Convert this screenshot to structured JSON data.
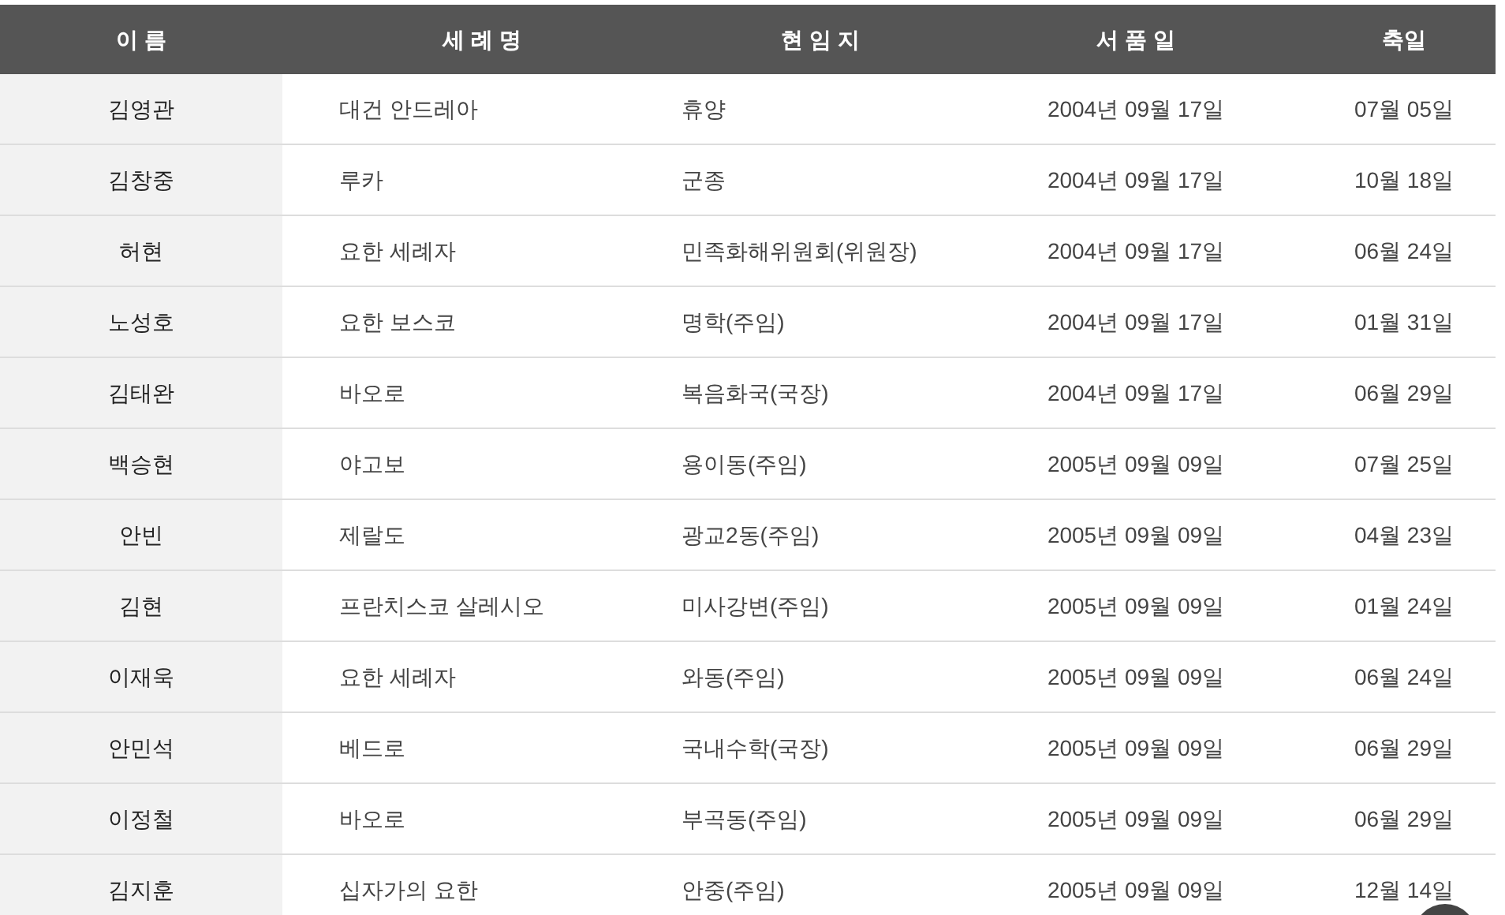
{
  "table": {
    "columns": [
      "이 름",
      "세 례 명",
      "현 임 지",
      "서 품 일",
      "축일"
    ],
    "rows": [
      [
        "김영관",
        "대건 안드레아",
        "휴양",
        "2004년 09월 17일",
        "07월 05일"
      ],
      [
        "김창중",
        "루카",
        "군종",
        "2004년 09월 17일",
        "10월 18일"
      ],
      [
        "허현",
        "요한 세례자",
        "민족화해위원회(위원장)",
        "2004년 09월 17일",
        "06월 24일"
      ],
      [
        "노성호",
        "요한 보스코",
        "명학(주임)",
        "2004년 09월 17일",
        "01월 31일"
      ],
      [
        "김태완",
        "바오로",
        "복음화국(국장)",
        "2004년 09월 17일",
        "06월 29일"
      ],
      [
        "백승현",
        "야고보",
        "용이동(주임)",
        "2005년 09월 09일",
        "07월 25일"
      ],
      [
        "안빈",
        "제랄도",
        "광교2동(주임)",
        "2005년 09월 09일",
        "04월 23일"
      ],
      [
        "김현",
        "프란치스코 살레시오",
        "미사강변(주임)",
        "2005년 09월 09일",
        "01월 24일"
      ],
      [
        "이재욱",
        "요한 세례자",
        "와동(주임)",
        "2005년 09월 09일",
        "06월 24일"
      ],
      [
        "안민석",
        "베드로",
        "국내수학(국장)",
        "2005년 09월 09일",
        "06월 29일"
      ],
      [
        "이정철",
        "바오로",
        "부곡동(주임)",
        "2005년 09월 09일",
        "06월 29일"
      ],
      [
        "김지훈",
        "십자가의 요한",
        "안중(주임)",
        "2005년 09월 09일",
        "12월 14일"
      ]
    ]
  }
}
